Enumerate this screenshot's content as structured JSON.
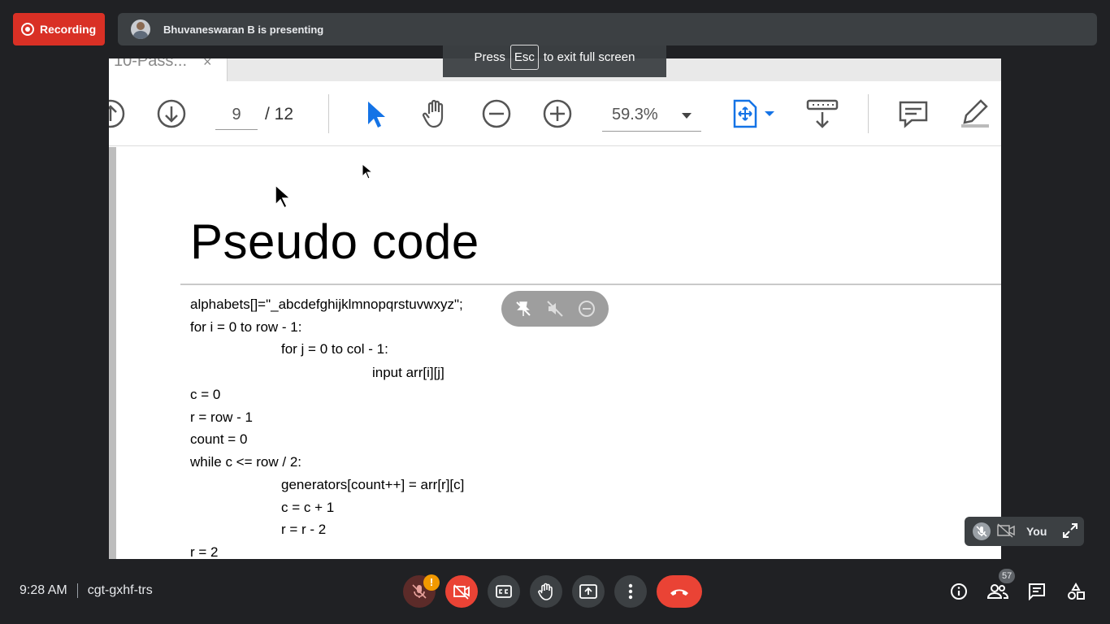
{
  "recording": {
    "label": "Recording"
  },
  "presenter": {
    "text": "Bhuvaneswaran B is presenting"
  },
  "fullscreen_toast": {
    "prefix": "Press",
    "key": "Esc",
    "suffix": "to exit full screen"
  },
  "shared_screen": {
    "tab": {
      "label": "10-Pass...",
      "close": "×"
    },
    "toolbar": {
      "current_page": "9",
      "total_pages": "/ 12",
      "zoom": "59.3%",
      "icons": [
        "scroll-up-icon",
        "scroll-down-icon",
        "select-pointer-icon",
        "hand-tool-icon",
        "zoom-out-icon",
        "zoom-in-icon",
        "fit-page-icon",
        "page-scroll-icon",
        "comment-icon",
        "highlight-pen-icon"
      ]
    },
    "document": {
      "title": "Pseudo code",
      "lines": [
        "alphabets[]=\"_abcdefghijklmnopqrstuvwxyz\";",
        "for i = 0 to row - 1:",
        "for j = 0 to col - 1:",
        "input arr[i][j]",
        "c = 0",
        "r = row - 1",
        "count = 0",
        "while c <= row / 2:",
        "generators[count++] = arr[r][c]",
        "c = c + 1",
        "r = r - 2",
        "r = 2"
      ]
    }
  },
  "self_tile": {
    "label": "You"
  },
  "meeting": {
    "time": "9:28 AM",
    "code": "cgt-gxhf-trs"
  },
  "controls": {
    "mic_warning": "!",
    "participants_count": "57"
  },
  "colors": {
    "accent_red": "#ea4335",
    "recording_red": "#d93025",
    "background": "#202124",
    "pdf_blue": "#1473e6"
  }
}
